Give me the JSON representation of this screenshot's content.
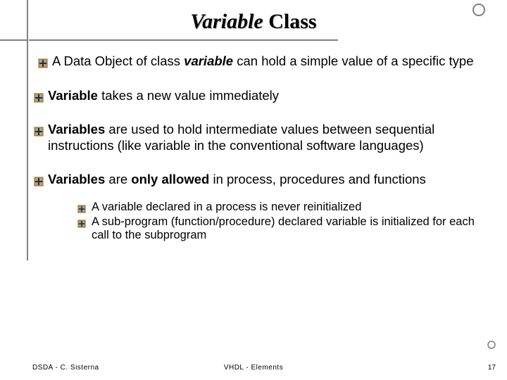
{
  "title": {
    "ital": "Variable",
    "rest": " Class"
  },
  "bullets": [
    {
      "pre": " A Data Object of class ",
      "bi": "variable",
      "post": " can hold a simple value of a specific type"
    },
    {
      "b": "Variable",
      "post": " takes a new value immediately"
    },
    {
      "pre": " ",
      "b": "Variables",
      "post": " are used to hold intermediate values between sequential instructions (like variable in the conventional software languages)"
    },
    {
      "pre": " ",
      "b1": "Variables",
      "mid": " are ",
      "b2": "only allowed",
      "post": " in process, procedures and functions"
    }
  ],
  "subbullets": [
    {
      "pre": "A ",
      "bi": "variable",
      "post": " declared in a process is never reinitialized"
    },
    {
      "pre": "A sub-program (function/procedure) declared ",
      "bi": "variable",
      "mid": " is ",
      "b": "initialized",
      "post": " for each call to the subprogram"
    }
  ],
  "footer": {
    "left": "DSDA - C. Sisterna",
    "center": "VHDL - Elements",
    "right": "17"
  }
}
